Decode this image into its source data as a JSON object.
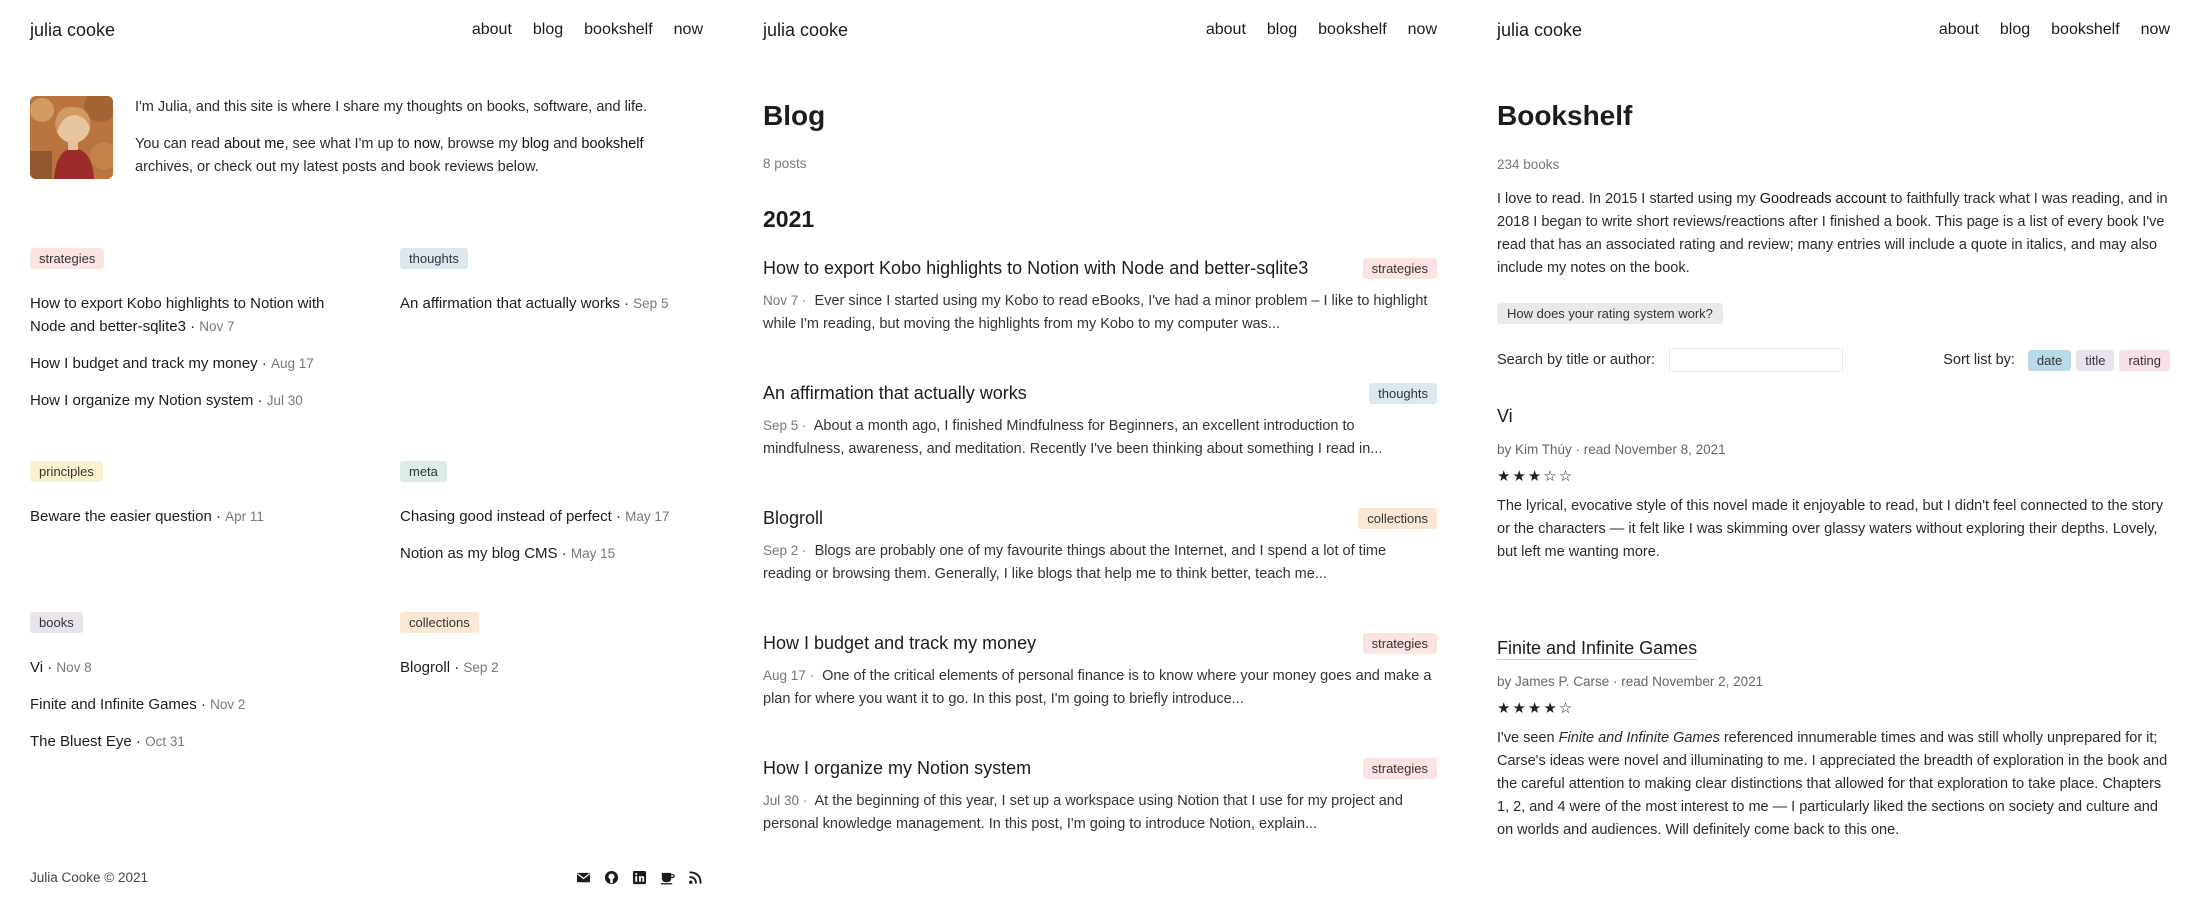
{
  "site": {
    "name": "julia cooke"
  },
  "nav": [
    "about",
    "blog",
    "bookshelf",
    "now"
  ],
  "home": {
    "intro_p1": "I'm Julia, and this site is where I share my thoughts on books, software, and life.",
    "intro_p2": {
      "t1": "You can read ",
      "about_link": "about me",
      "t2": ", see what I'm up to ",
      "now_link": "now",
      "t3": ", browse my ",
      "blog_link": "blog",
      "t4": " and ",
      "bookshelf_link": "bookshelf",
      "t5": " archives, or check out my latest posts and book reviews below."
    },
    "categories": [
      {
        "tag": "strategies",
        "posts": [
          {
            "title": "How to export Kobo highlights to Notion with Node and better-sqlite3",
            "date": "Nov 7"
          },
          {
            "title": "How I budget and track my money",
            "date": "Aug 17"
          },
          {
            "title": "How I organize my Notion system",
            "date": "Jul 30"
          }
        ]
      },
      {
        "tag": "thoughts",
        "posts": [
          {
            "title": "An affirmation that actually works",
            "date": "Sep 5"
          }
        ]
      },
      {
        "tag": "principles",
        "posts": [
          {
            "title": "Beware the easier question",
            "date": "Apr 11"
          }
        ]
      },
      {
        "tag": "meta",
        "posts": [
          {
            "title": "Chasing good instead of perfect",
            "date": "May 17"
          },
          {
            "title": "Notion as my blog CMS",
            "date": "May 15"
          }
        ]
      },
      {
        "tag": "books",
        "posts": [
          {
            "title": "Vi",
            "date": "Nov 8"
          },
          {
            "title": "Finite and Infinite Games",
            "date": "Nov 2"
          },
          {
            "title": "The Bluest Eye",
            "date": "Oct 31"
          }
        ]
      },
      {
        "tag": "collections",
        "posts": [
          {
            "title": "Blogroll",
            "date": "Sep 2"
          }
        ]
      }
    ],
    "footer_copy": "Julia Cooke © 2021",
    "footer_icons": [
      "mail-icon",
      "github-icon",
      "linkedin-icon",
      "coffee-icon",
      "rss-icon"
    ]
  },
  "blog": {
    "title": "Blog",
    "count": "8 posts",
    "year": "2021",
    "posts": [
      {
        "title": "How to export Kobo highlights to Notion with Node and better-sqlite3",
        "tag": "strategies",
        "date": "Nov 7 ·",
        "excerpt": "Ever since I started using my Kobo to read eBooks, I've had a minor problem – I like to highlight while I'm reading, but moving the highlights from my Kobo to my computer was..."
      },
      {
        "title": "An affirmation that actually works",
        "tag": "thoughts",
        "date": "Sep 5 ·",
        "excerpt": "About a month ago, I finished Mindfulness for Beginners, an excellent introduction to mindfulness, awareness, and meditation. Recently I've been thinking about something I read in..."
      },
      {
        "title": "Blogroll",
        "tag": "collections",
        "date": "Sep 2 ·",
        "excerpt": "Blogs are probably one of my favourite things about the Internet, and I spend a lot of time reading or browsing them. Generally, I like blogs that help me to think better, teach me..."
      },
      {
        "title": "How I budget and track my money",
        "tag": "strategies",
        "date": "Aug 17 ·",
        "excerpt": "One of the critical elements of personal finance is to know where your money goes and make a plan for where you want it to go. In this post, I'm going to briefly introduce..."
      },
      {
        "title": "How I organize my Notion system",
        "tag": "strategies",
        "date": "Jul 30 ·",
        "excerpt": "At the beginning of this year, I set up a workspace using Notion that I use for my project and personal knowledge management. In this post, I'm going to introduce Notion, explain..."
      }
    ]
  },
  "bookshelf": {
    "title": "Bookshelf",
    "count": "234 books",
    "desc": {
      "t1": "I love to read. In 2015 I started using my ",
      "link": "Goodreads account",
      "t2": " to faithfully track what I was reading, and in 2018 I began to write short reviews/reactions after I finished a book. This page is a list of every book I've read that has an associated rating and review; many entries will include a quote in italics, and may also include my notes on the book."
    },
    "rating_button": "How does your rating system work?",
    "search_label": "Search by title or author:",
    "search_value": "",
    "sort_label": "Sort list by:",
    "sort_options": [
      "date",
      "title",
      "rating"
    ],
    "sort_selected": "date",
    "books": [
      {
        "title": "Vi",
        "byline": "by Kim Thúy · read November 8, 2021",
        "rating": 3,
        "max_rating": 5,
        "stars": "★★★☆☆",
        "review": "The lyrical, evocative style of this novel made it enjoyable to read, but I didn't feel connected to the story or the characters — it felt like I was skimming over glassy waters without exploring their depths. Lovely, but left me wanting more."
      },
      {
        "title": "Finite and Infinite Games",
        "byline": "by James P. Carse · read November 2, 2021",
        "rating": 4,
        "max_rating": 5,
        "stars": "★★★★☆",
        "review_pre": "I've seen ",
        "review_em": "Finite and Infinite Games",
        "review_post": " referenced innumerable times and was still wholly unprepared for it; Carse's ideas were novel and illuminating to me. I appreciated the breadth of exploration in the book and the careful attention to making clear distinctions that allowed for that exploration to take place. Chapters 1, 2, and 4 were of the most interest to me — I particularly liked the sections on society and culture and on worlds and audiences. Will definitely come back to this one."
      }
    ]
  }
}
